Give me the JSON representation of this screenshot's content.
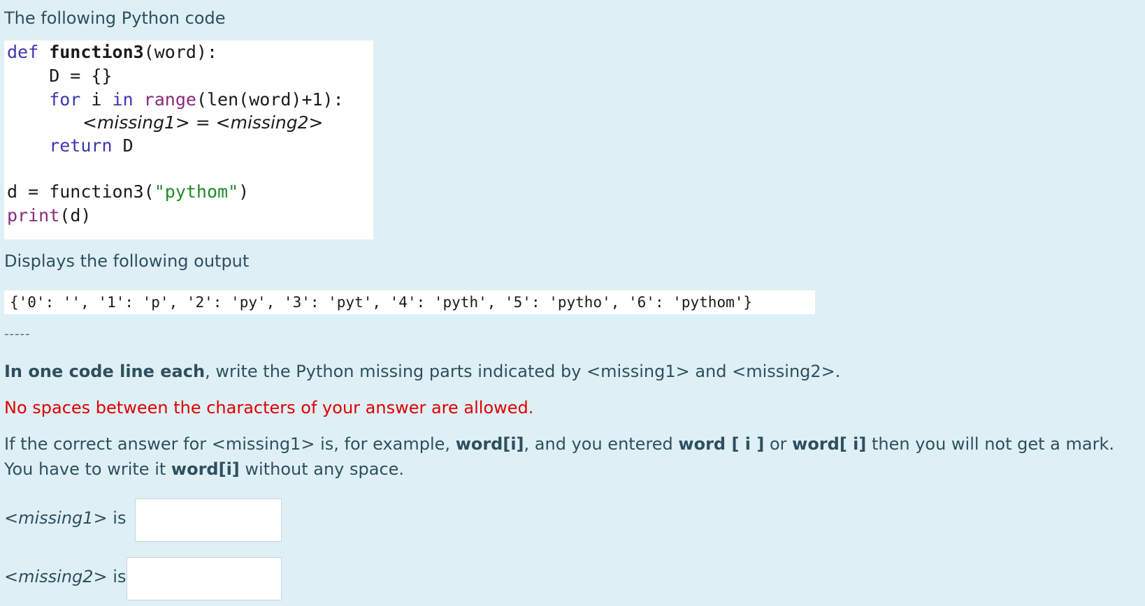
{
  "intro": "The following Python code",
  "code": {
    "line1_kw": "def",
    "line1_rest": " function3",
    "line1_args": "(word):",
    "line2": "    D = {}",
    "line3_kw1": "    for",
    "line3_mid": " i ",
    "line3_kw2": "in",
    "line3_fn": " range",
    "line3_rest": "(len(word)+1):",
    "line4_missing": "<missing1> = <missing2>",
    "line5_kw": "    return",
    "line5_rest": " D",
    "line6_pre": "d = function3(",
    "line6_str": "\"pythom\"",
    "line6_post": ")",
    "line7_fn": "print",
    "line7_rest": "(d)"
  },
  "output_label": "Displays the following output",
  "output": "{'0': '', '1': 'p', '2': 'py', '3': 'pyt', '4': 'pyth', '5': 'pytho', '6': 'pythom'}",
  "separator": "-----",
  "instruction": {
    "bold": "In one code line each",
    "rest": ", write the Python missing parts indicated by <missing1> and <missing2>."
  },
  "warning": "No spaces between the characters of your answer are allowed.",
  "example": {
    "p1": "If the correct answer for <missing1> is, for example, ",
    "b1": "word[i]",
    "p2": ", and you entered ",
    "b2": "word [ i ]",
    "p3": " or ",
    "b3": "word[ i]",
    "p4": " then you will not get a mark. You have to write it ",
    "b4": "word[i]",
    "p5": " without any space."
  },
  "answer1": {
    "label_italic": "<missing1>",
    "label_rest": " is",
    "value": ""
  },
  "answer2": {
    "label_italic": "<missing2>",
    "label_rest": " is",
    "value": ""
  }
}
